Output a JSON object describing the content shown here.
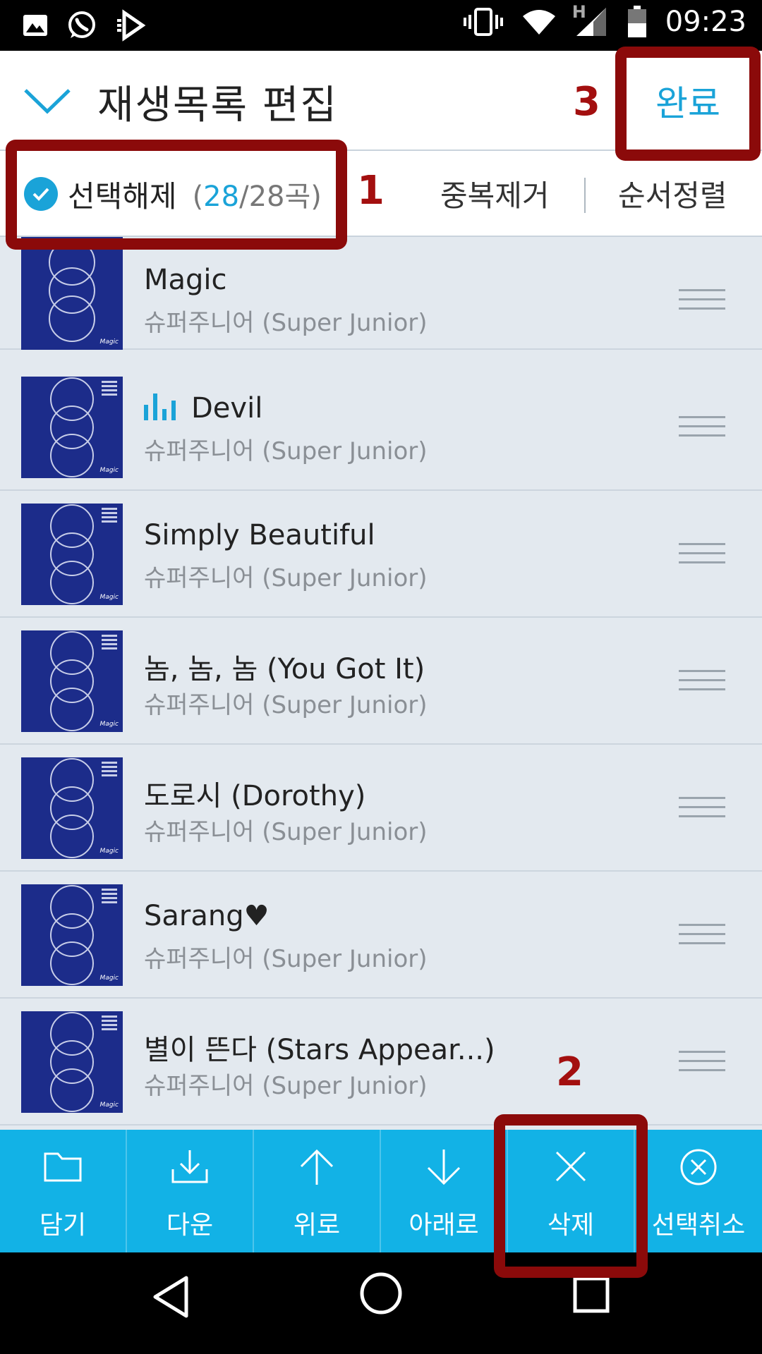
{
  "status_bar": {
    "time": "09:23",
    "network_type": "H",
    "left_icons": [
      "image-icon",
      "whatsapp-icon",
      "media-play-icon"
    ],
    "right_icons": [
      "vibrate-icon",
      "wifi-icon",
      "signal-icon",
      "battery-icon"
    ]
  },
  "header": {
    "title": "재생목록 편집",
    "collapse_icon": "chevron-down-icon",
    "done_label": "완료"
  },
  "toolbar": {
    "deselect_label": "선택해제",
    "count_open": "(",
    "selected_count": "28",
    "count_separator": "/",
    "total_count": "28곡",
    "count_close": ")",
    "dedupe_label": "중복제거",
    "sort_label": "순서정렬"
  },
  "annotations": {
    "marker_1": "1",
    "marker_2": "2",
    "marker_3": "3",
    "color": "#8b0a0a"
  },
  "songs": [
    {
      "title": "Magic",
      "artist": "슈퍼주니어 (Super Junior)",
      "playing": false
    },
    {
      "title": "Devil",
      "artist": "슈퍼주니어 (Super Junior)",
      "playing": true
    },
    {
      "title": "Simply Beautiful",
      "artist": "슈퍼주니어 (Super Junior)",
      "playing": false
    },
    {
      "title": "놈, 놈, 놈 (You Got It)",
      "artist": "슈퍼주니어 (Super Junior)",
      "playing": false
    },
    {
      "title": "도로시 (Dorothy)",
      "artist": "슈퍼주니어 (Super Junior)",
      "playing": false
    },
    {
      "title": "Sarang♥",
      "artist": "슈퍼주니어 (Super Junior)",
      "playing": false
    },
    {
      "title": "별이 뜬다 (Stars Appear...)",
      "artist": "슈퍼주니어 (Super Junior)",
      "playing": false
    }
  ],
  "album_art_caption": "Magic",
  "action_bar": {
    "items": [
      {
        "label": "담기",
        "icon": "folder-icon"
      },
      {
        "label": "다운",
        "icon": "download-icon"
      },
      {
        "label": "위로",
        "icon": "arrow-up-icon"
      },
      {
        "label": "아래로",
        "icon": "arrow-down-icon"
      },
      {
        "label": "삭제",
        "icon": "close-icon"
      },
      {
        "label": "선택취소",
        "icon": "cancel-circle-icon"
      }
    ]
  },
  "nav_bar": {
    "buttons": [
      "back-icon",
      "home-icon",
      "recents-icon"
    ]
  },
  "colors": {
    "accent": "#1aa3d8",
    "action_bar": "#12b2e6",
    "list_bg": "#e3e9ef",
    "album_blue": "#1c2c8a"
  }
}
